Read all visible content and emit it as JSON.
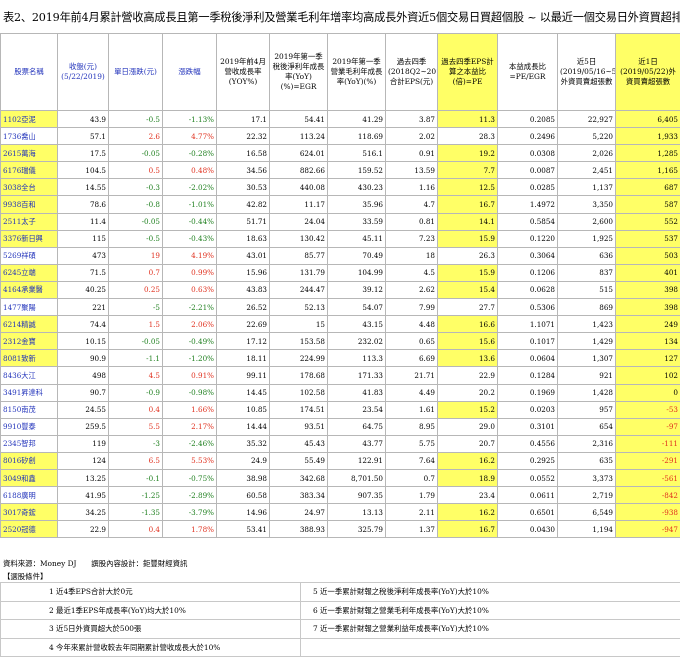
{
  "title": "表2、2019年前4月累計營收高成長且第一季稅後淨利及營業毛利年增率均高成長外資近5個交易日買超個股 ~ 以最近一個交易日外資買超排序",
  "headers": [
    "股票名稱",
    "收盤(元) (5/22/2019)",
    "單日漲跌(元)",
    "漲跌幅",
    "2019年前4月營收成長率(YOY%)",
    "2019年第一季稅後淨利年成長率(YoY)(%)=EGR",
    "2019年第一季營業毛利年成長率(YoY)(%)",
    "過去四季(2018Q2~2019Q1)合計EPS(元)",
    "過去四季EPS計算之本益比(倍)=PE",
    "本益成長比=PE/EGR",
    "近5日(2019/05/16~5/22)外資買賣超張數",
    "近1日(2019/05/22)外資買賣超張數"
  ],
  "rows": [
    [
      "1102亞泥",
      "43.9",
      "-0.5",
      "-1.13%",
      "17.1",
      "54.41",
      "41.29",
      "3.87",
      "11.3",
      "0.2085",
      "22,927",
      "6,405"
    ],
    [
      "1736喬山",
      "57.1",
      "2.6",
      "4.77%",
      "22.32",
      "113.24",
      "118.69",
      "2.02",
      "28.3",
      "0.2496",
      "5,220",
      "1,933"
    ],
    [
      "2615萬海",
      "17.5",
      "-0.05",
      "-0.28%",
      "16.58",
      "624.01",
      "516.1",
      "0.91",
      "19.2",
      "0.0308",
      "2,026",
      "1,285"
    ],
    [
      "6176瑞儀",
      "104.5",
      "0.5",
      "0.48%",
      "34.56",
      "882.66",
      "159.52",
      "13.59",
      "7.7",
      "0.0087",
      "2,451",
      "1,165"
    ],
    [
      "3038全台",
      "14.55",
      "-0.3",
      "-2.02%",
      "30.53",
      "440.08",
      "430.23",
      "1.16",
      "12.5",
      "0.0285",
      "1,137",
      "687"
    ],
    [
      "9938百和",
      "78.6",
      "-0.8",
      "-1.01%",
      "42.82",
      "11.17",
      "35.96",
      "4.7",
      "16.7",
      "1.4972",
      "3,350",
      "587"
    ],
    [
      "2511太子",
      "11.4",
      "-0.05",
      "-0.44%",
      "51.71",
      "24.04",
      "33.59",
      "0.81",
      "14.1",
      "0.5854",
      "2,600",
      "552"
    ],
    [
      "3376新日興",
      "115",
      "-0.5",
      "-0.43%",
      "18.63",
      "130.42",
      "45.11",
      "7.23",
      "15.9",
      "0.1220",
      "1,925",
      "537"
    ],
    [
      "5269祥碩",
      "473",
      "19",
      "4.19%",
      "43.01",
      "85.77",
      "70.49",
      "18",
      "26.3",
      "0.3064",
      "636",
      "503"
    ],
    [
      "6245立端",
      "71.5",
      "0.7",
      "0.99%",
      "15.96",
      "131.79",
      "104.99",
      "4.5",
      "15.9",
      "0.1206",
      "837",
      "401"
    ],
    [
      "4164承業醫",
      "40.25",
      "0.25",
      "0.63%",
      "43.83",
      "244.47",
      "39.12",
      "2.62",
      "15.4",
      "0.0628",
      "515",
      "398"
    ],
    [
      "1477聚陽",
      "221",
      "-5",
      "-2.21%",
      "26.52",
      "52.13",
      "54.07",
      "7.99",
      "27.7",
      "0.5306",
      "869",
      "398"
    ],
    [
      "6214精誠",
      "74.4",
      "1.5",
      "2.06%",
      "22.69",
      "15",
      "43.15",
      "4.48",
      "16.6",
      "1.1071",
      "1,423",
      "249"
    ],
    [
      "2312金寶",
      "10.15",
      "-0.05",
      "-0.49%",
      "17.12",
      "153.58",
      "232.02",
      "0.65",
      "15.6",
      "0.1017",
      "1,429",
      "134"
    ],
    [
      "8081致新",
      "90.9",
      "-1.1",
      "-1.20%",
      "18.11",
      "224.99",
      "113.3",
      "6.69",
      "13.6",
      "0.0604",
      "1,307",
      "127"
    ],
    [
      "8436大江",
      "498",
      "4.5",
      "0.91%",
      "99.11",
      "178.68",
      "171.33",
      "21.71",
      "22.9",
      "0.1284",
      "921",
      "102"
    ],
    [
      "3491昇達科",
      "90.7",
      "-0.9",
      "-0.98%",
      "14.45",
      "102.58",
      "41.83",
      "4.49",
      "20.2",
      "0.1969",
      "1,428",
      "0"
    ],
    [
      "8150南茂",
      "24.55",
      "0.4",
      "1.66%",
      "10.85",
      "174.51",
      "23.54",
      "1.61",
      "15.2",
      "0.0203",
      "957",
      "-53"
    ],
    [
      "9910豐泰",
      "259.5",
      "5.5",
      "2.17%",
      "14.44",
      "93.51",
      "64.75",
      "8.95",
      "29.0",
      "0.3101",
      "654",
      "-97"
    ],
    [
      "2345智邦",
      "119",
      "-3",
      "-2.46%",
      "35.32",
      "45.43",
      "43.77",
      "5.75",
      "20.7",
      "0.4556",
      "2,316",
      "-111"
    ],
    [
      "8016矽創",
      "124",
      "6.5",
      "5.53%",
      "24.9",
      "55.49",
      "122.91",
      "7.64",
      "16.2",
      "0.2925",
      "635",
      "-291"
    ],
    [
      "3049和鑫",
      "13.25",
      "-0.1",
      "-0.75%",
      "38.98",
      "342.68",
      "8,701.50",
      "0.7",
      "18.9",
      "0.0552",
      "3,373",
      "-561"
    ],
    [
      "6188廣明",
      "41.95",
      "-1.25",
      "-2.89%",
      "60.58",
      "383.34",
      "907.35",
      "1.79",
      "23.4",
      "0.0611",
      "2,719",
      "-842"
    ],
    [
      "3017奇鋐",
      "34.25",
      "-1.35",
      "-3.79%",
      "14.96",
      "24.97",
      "13.13",
      "2.11",
      "16.2",
      "0.6501",
      "6,549",
      "-938"
    ],
    [
      "2520冠德",
      "22.9",
      "0.4",
      "1.78%",
      "53.41",
      "388.93",
      "325.79",
      "1.37",
      "16.7",
      "0.0430",
      "1,194",
      "-947"
    ]
  ],
  "source": "資料來源：Money DJ　　譔股內容設計：鉅豐財經資訊",
  "conditions_title": "【選股條件】",
  "conditions": [
    [
      "1 近4季EPS合計大於0元",
      "5 近一季累計財報之稅後淨利年成長率(YoY)大於10%"
    ],
    [
      "2 最近1季EPS年成長率(YoY)均大於10%",
      "6 近一季累計財報之營業毛利年成長率(YoY)大於10%"
    ],
    [
      "3 近5日外資買超大於500張",
      "7 近一季累計財報之營業利益年成長率(YoY)大於10%"
    ],
    [
      "4 今年來累計營收較去年同期累計營收成長大於10%",
      ""
    ]
  ],
  "colors": {
    "highlight": "#ffff66",
    "up": "#e0301e",
    "down": "#1e7f1e",
    "name": "#2233bb"
  }
}
